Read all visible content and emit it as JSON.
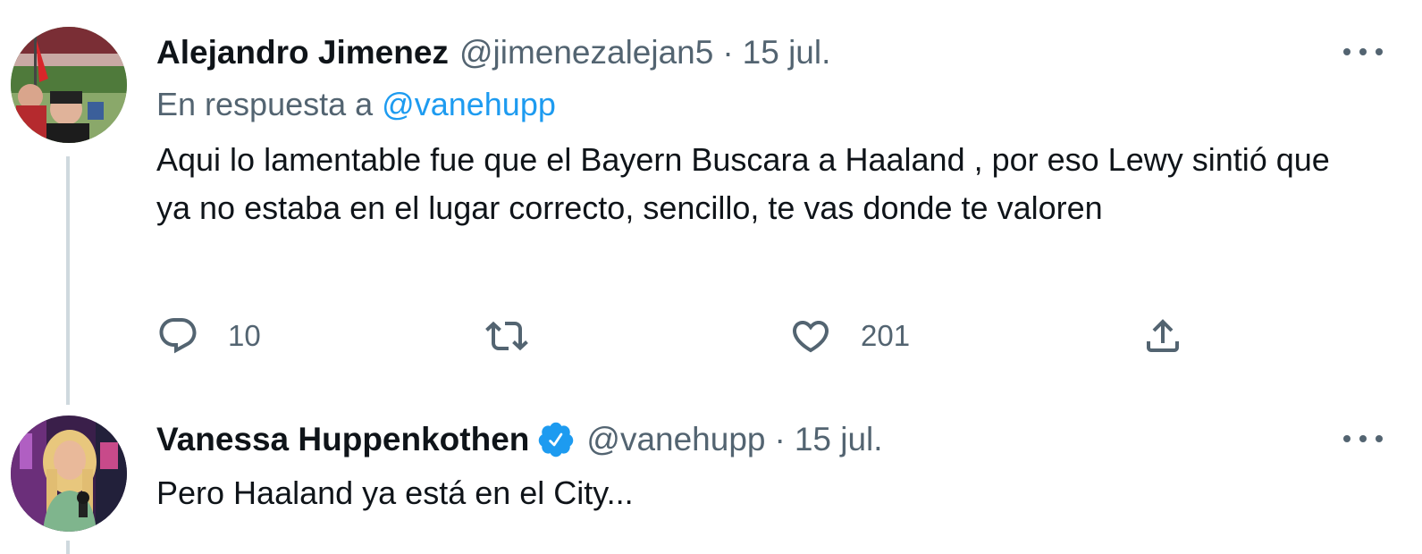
{
  "tweets": [
    {
      "author_name": "Alejandro Jimenez",
      "handle": "@jimenezalejan5",
      "separator": "·",
      "date": "15 jul.",
      "reply_prefix": "En respuesta a",
      "reply_mention": "@vanehupp",
      "text": "Aqui lo lamentable fue que el Bayern Buscara a Haaland , por eso Lewy sintió que ya no estaba en el lugar correcto, sencillo, te vas donde te valoren",
      "replies": "10",
      "likes": "201"
    },
    {
      "author_name": "Vanessa Huppenkothen",
      "verified": true,
      "handle": "@vanehupp",
      "separator": "·",
      "date": "15 jul.",
      "text": "Pero Haaland ya está en el City..."
    }
  ],
  "icons": {
    "more": "more-icon",
    "reply": "reply-icon",
    "retweet": "retweet-icon",
    "like": "heart-icon",
    "share": "share-icon",
    "verified": "verified-badge-icon"
  },
  "colors": {
    "text": "#0f1419",
    "secondary": "#536471",
    "link": "#1d9bf0",
    "verified": "#1d9bf0",
    "thread_line": "#cfd9de"
  }
}
